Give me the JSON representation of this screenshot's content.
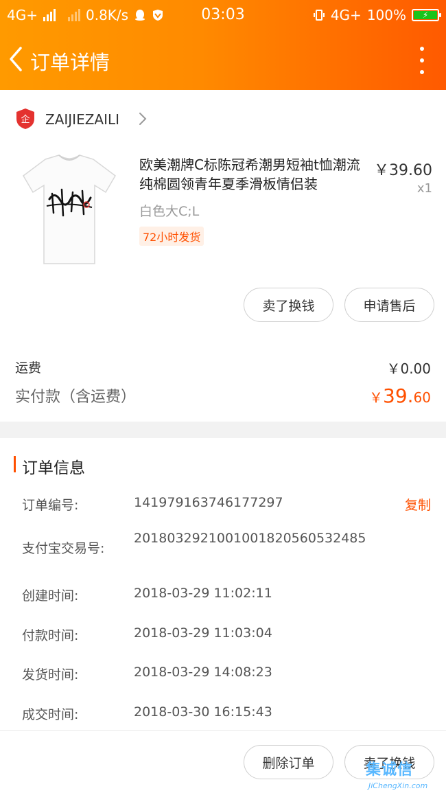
{
  "status_bar": {
    "network_left": "4G+",
    "speed": "0.8K/s",
    "time": "03:03",
    "network_right": "4G+",
    "battery": "100%"
  },
  "nav": {
    "title": "订单详情",
    "back_icon": "chevron-left-icon",
    "more_icon": "more-vertical-icon"
  },
  "shop": {
    "name": "ZAIJIEZAILI",
    "logo_icon": "enterprise-badge-icon",
    "logo_text": "企"
  },
  "product": {
    "title": "欧美潮牌C标陈冠希潮男短袖t恤潮流纯棉圆领青年夏季滑板情侣装",
    "price": "￥39.60",
    "qty": "x1",
    "sku": "白色大C;L",
    "tag": "72小时发货",
    "buttons": {
      "sell": "卖了换钱",
      "after_sales": "申请售后"
    }
  },
  "fees": {
    "shipping_label": "运费",
    "shipping_value": "￥0.00",
    "paid_label": "实付款（含运费）",
    "paid_symbol": "￥",
    "paid_int": "39.",
    "paid_dec": "60"
  },
  "order_info": {
    "title": "订单信息",
    "rows": [
      {
        "label": "订单编号:",
        "value": "141979163746177297"
      },
      {
        "label": "支付宝交易号:",
        "value": "2018032921001001820560532485"
      },
      {
        "label": "创建时间:",
        "value": "2018-03-29 11:02:11"
      },
      {
        "label": "付款时间:",
        "value": "2018-03-29 11:03:04"
      },
      {
        "label": "发货时间:",
        "value": "2018-03-29 14:08:23"
      },
      {
        "label": "成交时间:",
        "value": "2018-03-30 16:15:43"
      }
    ],
    "copy_label": "复制"
  },
  "bottom_bar": {
    "delete_label": "删除订单",
    "sell_label": "卖了换钱"
  },
  "watermark": {
    "main": "集诚信",
    "sub": "JiChengXin.com"
  },
  "colors": {
    "accent": "#ff5000",
    "header_start": "#ff9a00",
    "header_end": "#ff5a00"
  }
}
